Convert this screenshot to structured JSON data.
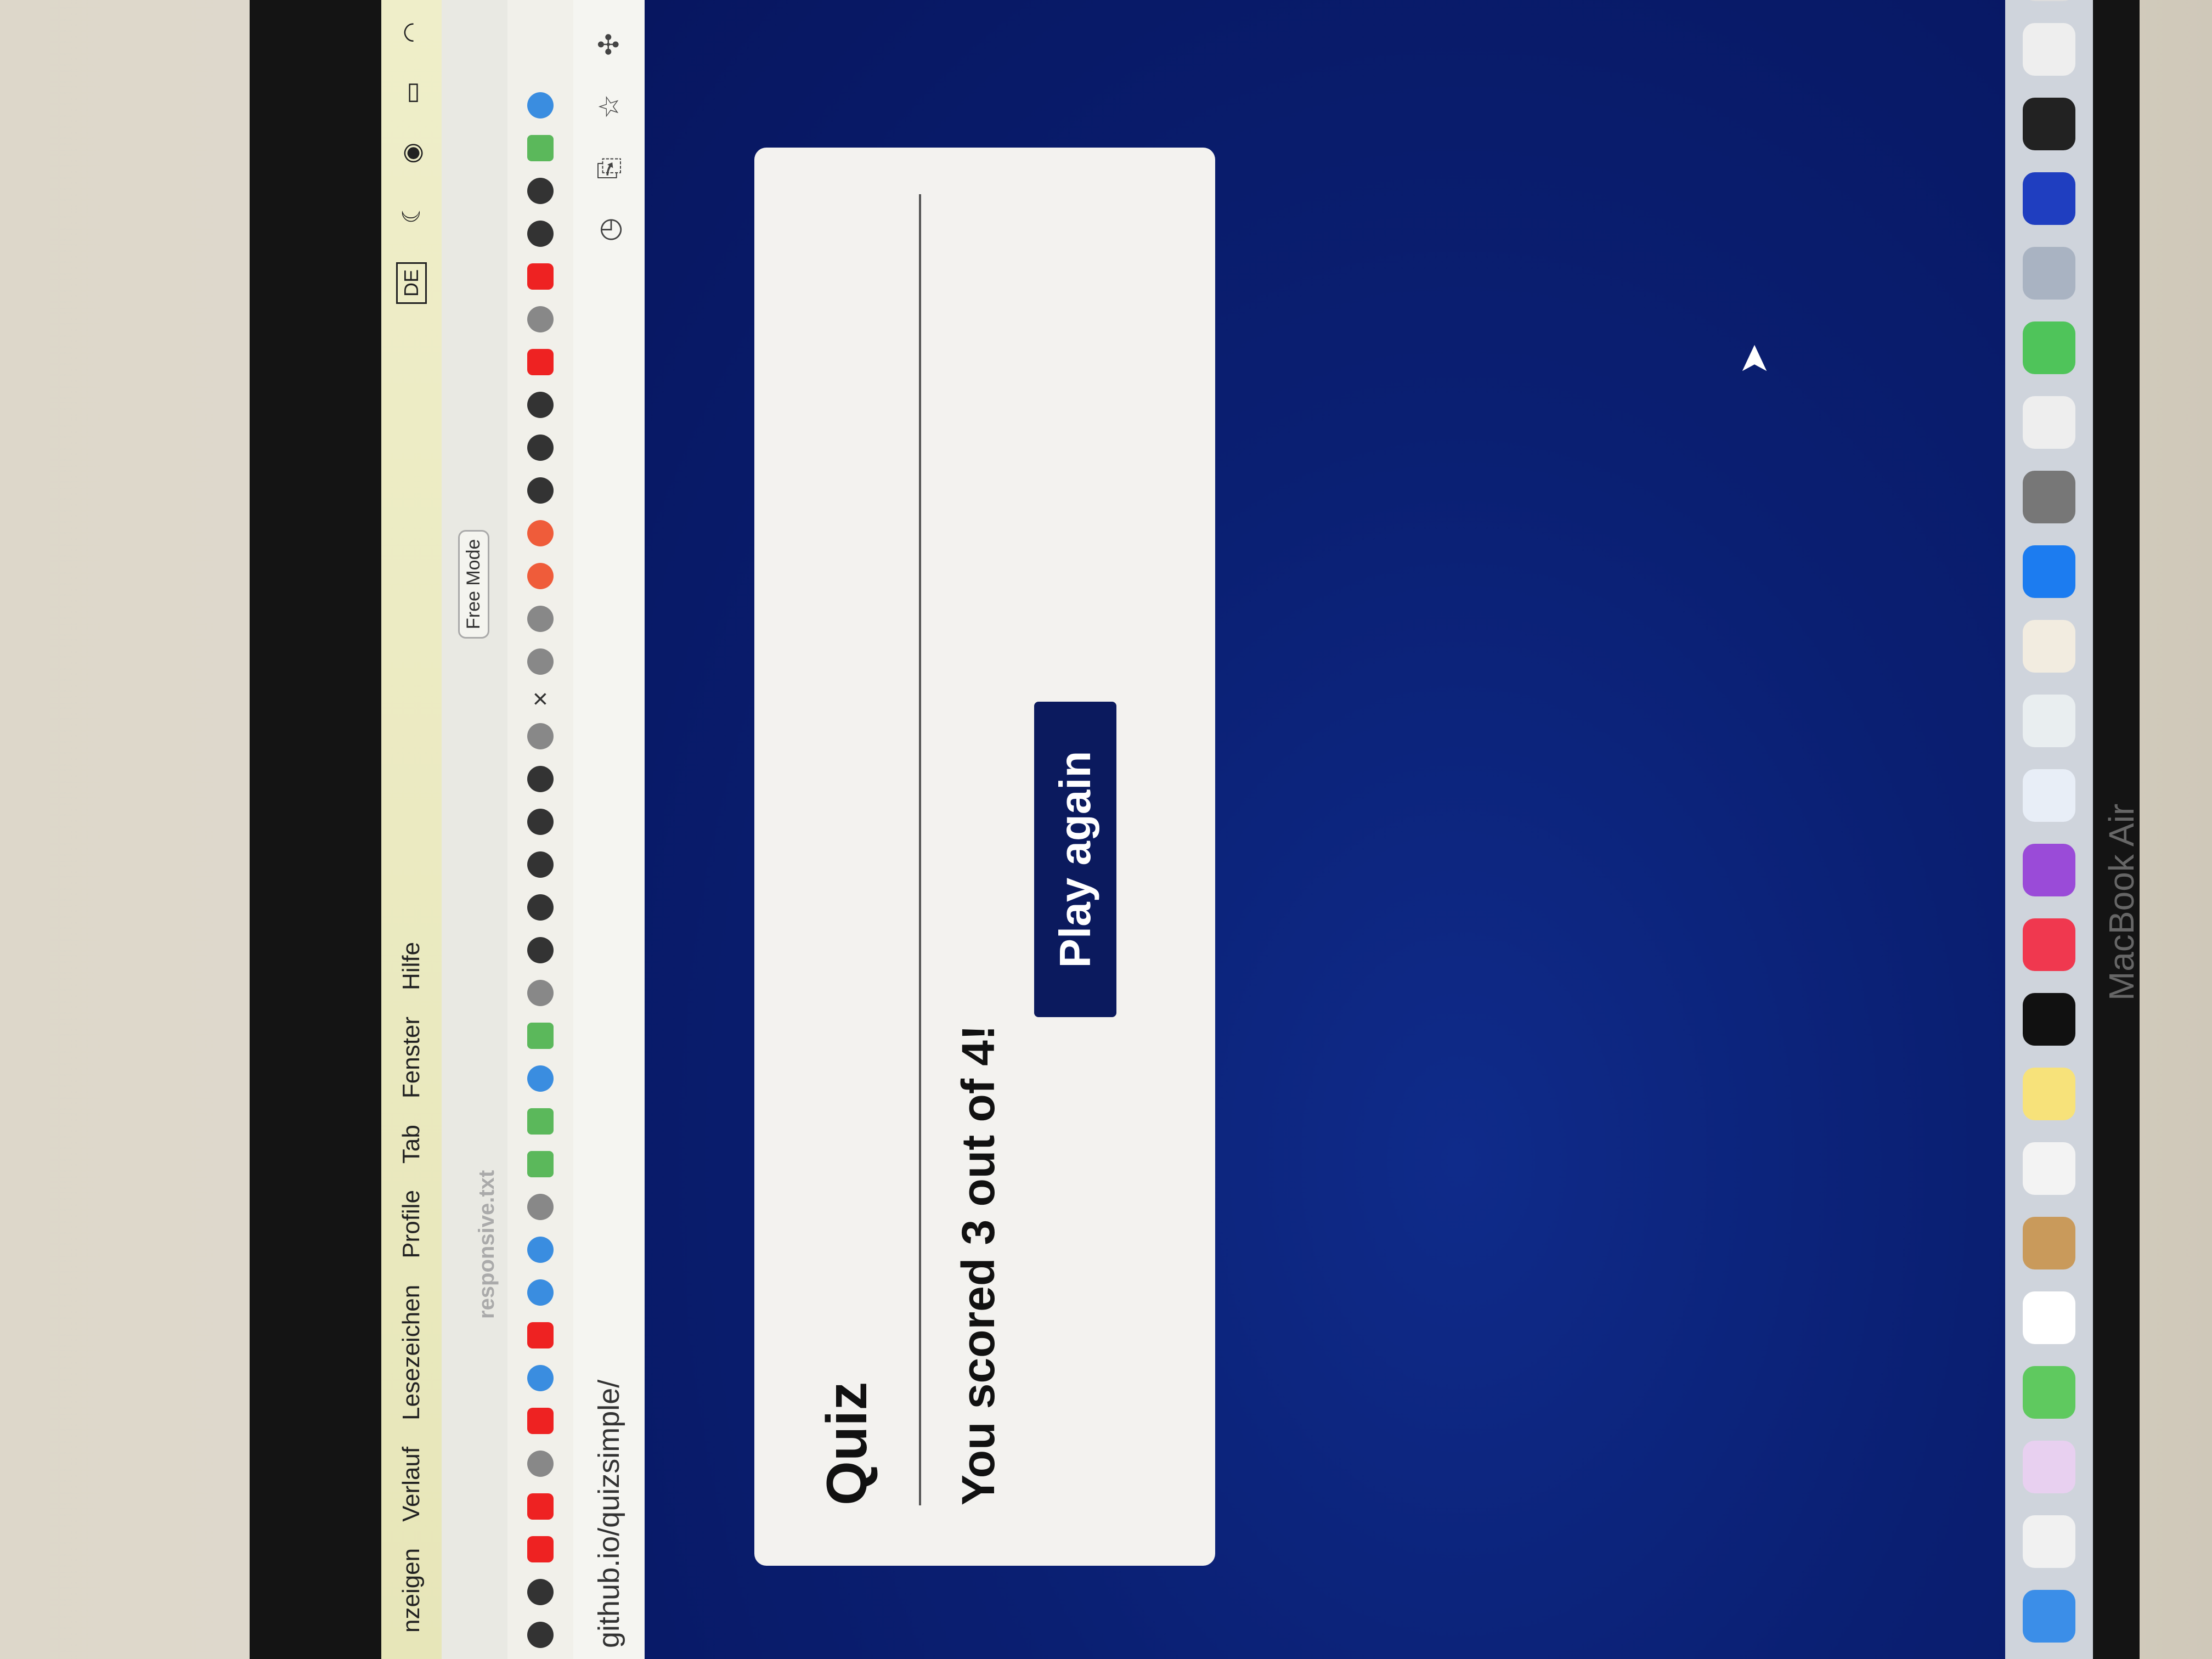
{
  "menubar": {
    "items": [
      "nzeigen",
      "Verlauf",
      "Lesezeichen",
      "Profile",
      "Tab",
      "Fenster",
      "Hilfe"
    ],
    "input_source": "DE"
  },
  "tabs": {
    "file_tab": "responsive.txt",
    "mode_badge": "Free Mode",
    "close": "×"
  },
  "address": {
    "url": "github.io/quizsimple/"
  },
  "quiz": {
    "title": "Quiz",
    "score_text": "You scored 3 out of 4!",
    "play_again_label": "Play again"
  },
  "device": {
    "brand": "MacBook Air"
  },
  "colors": {
    "page_background": "#0a1f72",
    "card_background": "#f3f2ef",
    "button_background": "#0b1a5e",
    "menubar_background": "#e7e6b9"
  }
}
